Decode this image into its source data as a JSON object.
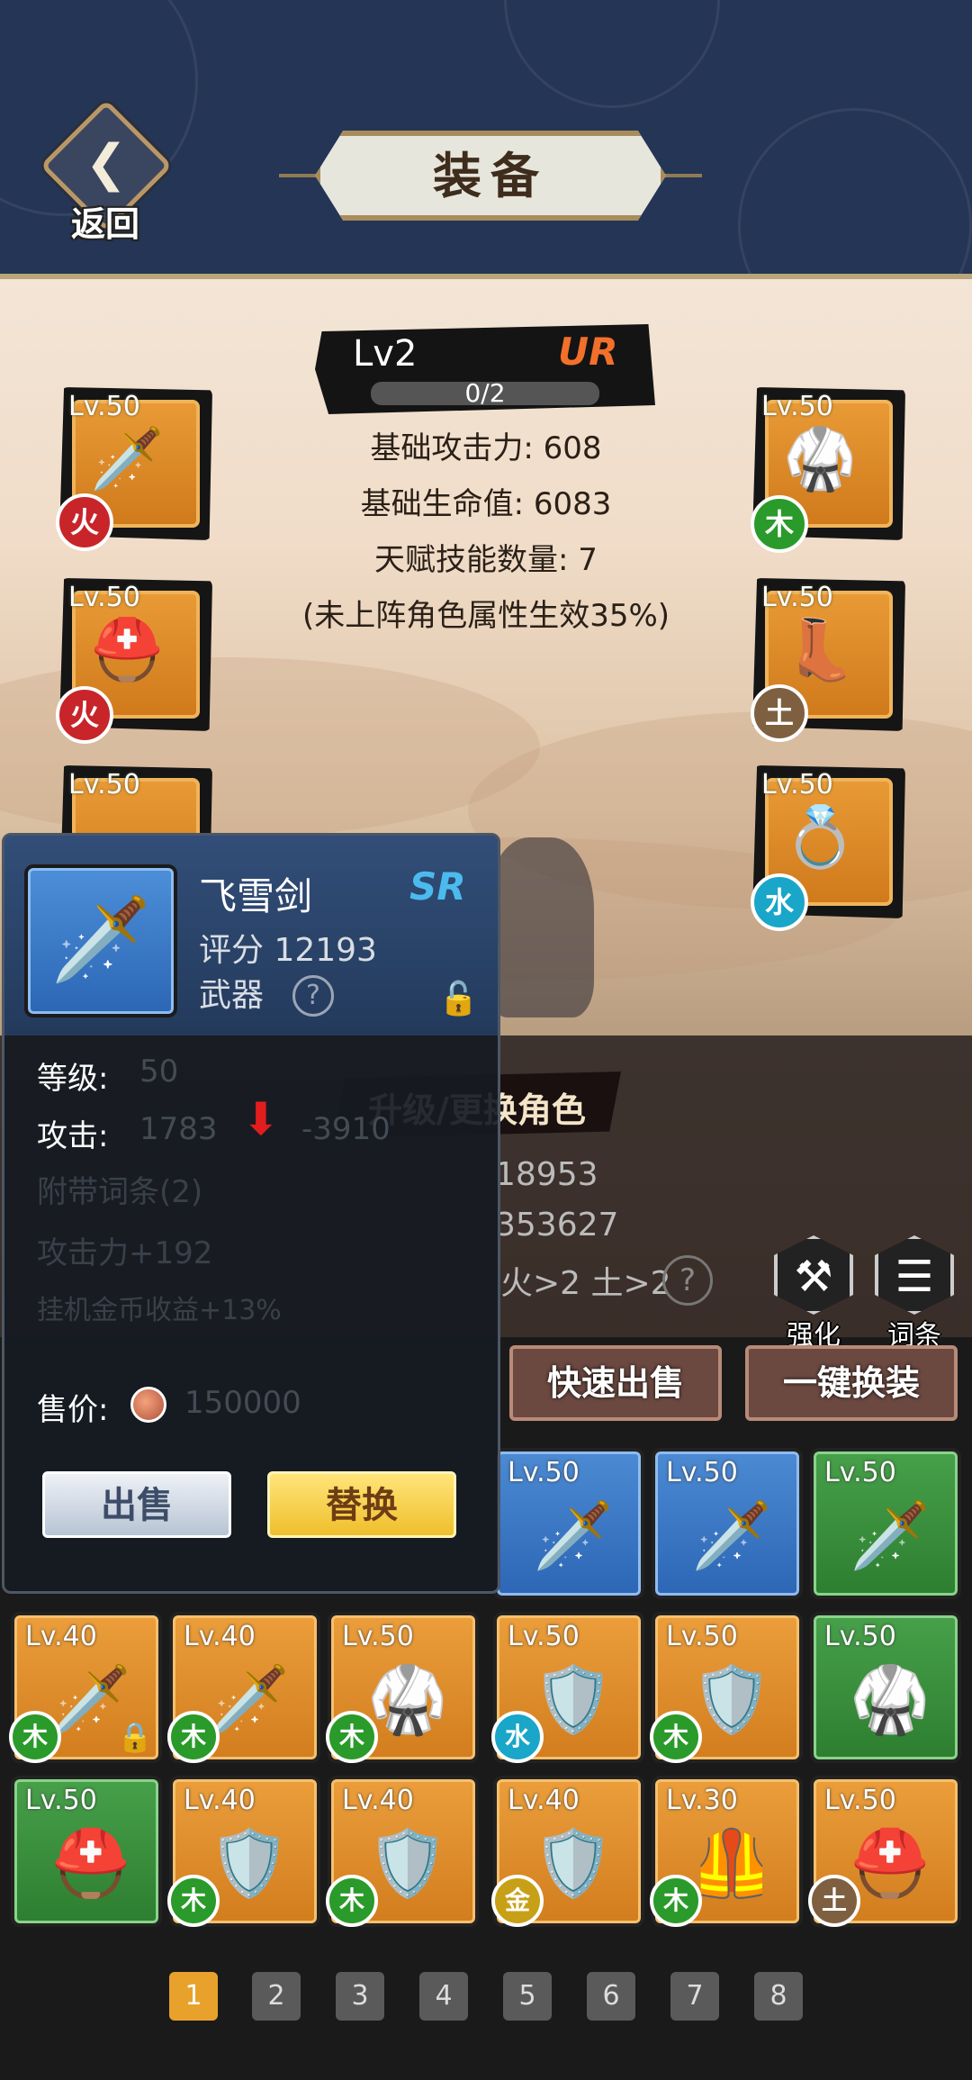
{
  "header": {
    "back_label": "返回",
    "title": "装备"
  },
  "hero": {
    "level": "Lv2",
    "rarity": "UR",
    "progress": "0/2",
    "progress_fraction": 0,
    "stats": [
      "基础攻击力: 608",
      "基础生命值: 6083",
      "天赋技能数量: 7",
      "(未上阵角色属性生效35%)"
    ],
    "upgrade_label": "升级/更换角色",
    "total_attack_value": "18953",
    "total_hp_value": "353627",
    "element_req": "火>2 土>2"
  },
  "equip_left": [
    {
      "level": "Lv.50",
      "icon": "sword-icon",
      "element": "火"
    },
    {
      "level": "Lv.50",
      "icon": "helmet-icon",
      "element": "火"
    },
    {
      "level": "Lv.50",
      "icon": "accessory-icon",
      "element": ""
    }
  ],
  "equip_right": [
    {
      "level": "Lv.50",
      "icon": "armor-icon",
      "element": "木"
    },
    {
      "level": "Lv.50",
      "icon": "boots-icon",
      "element": "土"
    },
    {
      "level": "Lv.50",
      "icon": "ring-icon",
      "element": "水"
    }
  ],
  "tools": {
    "enhance": "强化",
    "affix": "词条"
  },
  "actions": {
    "quick_sell": "快速出售",
    "auto_equip": "一键换装"
  },
  "inventory": {
    "row1": [
      {
        "level": "Lv.50",
        "tier": "blue",
        "icon": "sword-icon",
        "element": ""
      },
      {
        "level": "Lv.50",
        "tier": "blue",
        "icon": "sword-icon",
        "element": ""
      },
      {
        "level": "Lv.50",
        "tier": "green",
        "icon": "sword-icon",
        "element": ""
      }
    ],
    "row2": [
      {
        "level": "Lv.40",
        "tier": "orange",
        "icon": "sword-icon",
        "element": "木",
        "locked": true
      },
      {
        "level": "Lv.40",
        "tier": "orange",
        "icon": "sword-icon",
        "element": "木"
      },
      {
        "level": "Lv.50",
        "tier": "orange",
        "icon": "armor-icon",
        "element": "木"
      },
      {
        "level": "Lv.50",
        "tier": "orange",
        "icon": "armor-icon",
        "element": "水"
      },
      {
        "level": "Lv.50",
        "tier": "orange",
        "icon": "armor-icon",
        "element": "木"
      },
      {
        "level": "Lv.50",
        "tier": "green",
        "icon": "armor-icon",
        "element": ""
      }
    ],
    "row3": [
      {
        "level": "Lv.50",
        "tier": "green",
        "icon": "helmet-icon",
        "element": ""
      },
      {
        "level": "Lv.40",
        "tier": "orange",
        "icon": "armor-icon",
        "element": "木"
      },
      {
        "level": "Lv.40",
        "tier": "orange",
        "icon": "armor-icon",
        "element": "木"
      },
      {
        "level": "Lv.40",
        "tier": "orange",
        "icon": "armor-icon",
        "element": "金"
      },
      {
        "level": "Lv.30",
        "tier": "orange",
        "icon": "armor-icon",
        "element": "木"
      },
      {
        "level": "Lv.50",
        "tier": "orange",
        "icon": "helmet-icon",
        "element": "土"
      }
    ]
  },
  "pagination": {
    "pages": [
      "1",
      "2",
      "3",
      "4",
      "5",
      "6",
      "7",
      "8"
    ],
    "current": "1"
  },
  "tooltip": {
    "name": "飞雪剑",
    "rarity": "SR",
    "score": "评分 12193",
    "type": "武器",
    "level_label": "等级:",
    "level_value": "50",
    "attack_label": "攻击:",
    "attack_value": "1783",
    "attack_compare": "-3910",
    "affix_header": "附带词条(2)",
    "affix_1": "攻击力+192",
    "affix_2": "挂机金币收益+13%",
    "price_label": "售价:",
    "price_value": "150000",
    "sell_button": "出售",
    "replace_button": "替换"
  },
  "colors": {
    "header_bg": "#243556",
    "tier_orange": "#e08a2a",
    "tier_blue": "#3a78c8",
    "tier_green": "#3a9040",
    "page_active": "#e8a22c"
  }
}
